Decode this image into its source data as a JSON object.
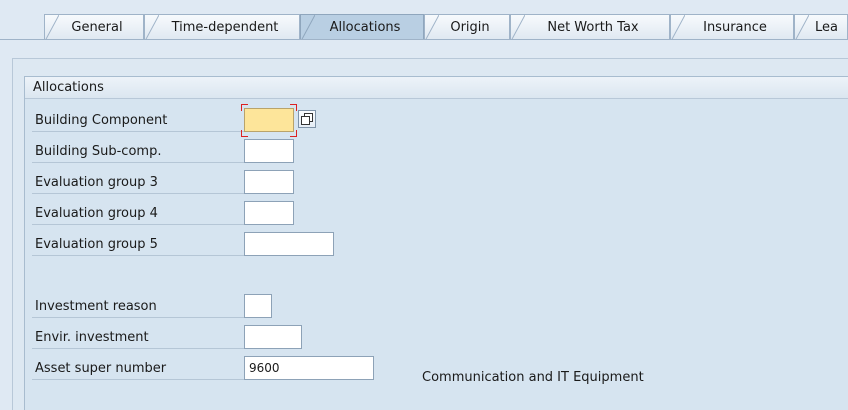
{
  "tabs": [
    {
      "label": "General",
      "active": false
    },
    {
      "label": "Time-dependent",
      "active": false
    },
    {
      "label": "Allocations",
      "active": true
    },
    {
      "label": "Origin",
      "active": false
    },
    {
      "label": "Net Worth Tax",
      "active": false
    },
    {
      "label": "Insurance",
      "active": false
    },
    {
      "label": "Lea",
      "active": false
    }
  ],
  "group": {
    "title": "Allocations"
  },
  "fields": {
    "building_component": {
      "label": "Building Component",
      "value": ""
    },
    "building_sub_comp": {
      "label": "Building Sub-comp.",
      "value": ""
    },
    "evaluation_group_3": {
      "label": "Evaluation group 3",
      "value": ""
    },
    "evaluation_group_4": {
      "label": "Evaluation group 4",
      "value": ""
    },
    "evaluation_group_5": {
      "label": "Evaluation group 5",
      "value": ""
    },
    "investment_reason": {
      "label": "Investment reason",
      "value": ""
    },
    "envir_investment": {
      "label": "Envir. investment",
      "value": ""
    },
    "asset_super_number": {
      "label": "Asset super number",
      "value": "9600",
      "description": "Communication and IT Equipment"
    }
  },
  "colors": {
    "required_field": "#fde59a",
    "active_tab": "#b9cfe3",
    "background": "#dfe9f3"
  },
  "icons": {
    "value_help": "value-help-icon"
  }
}
